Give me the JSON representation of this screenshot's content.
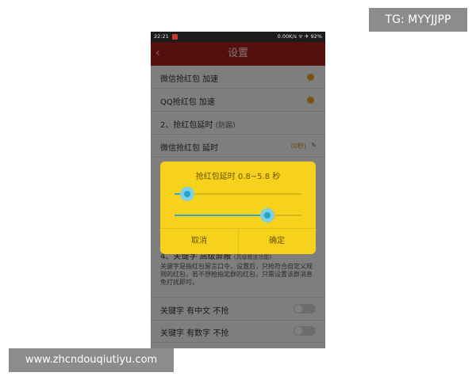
{
  "watermarks": {
    "tg": "TG: MYYJJPP",
    "url": "www.zhcndouqiutiyu.com"
  },
  "statusbar": {
    "time": "22:21",
    "right": "0.00K/s  ᯤ  ✈  92%"
  },
  "header": {
    "back_icon": "‹",
    "title": "设置"
  },
  "settings": {
    "wechat_speed": "微信抢红包 加速",
    "qq_speed": "QQ抢红包 加速",
    "delay_section": "2、抢红包延时",
    "delay_hint": "(防踢)",
    "wechat_delay": "微信抢红包 延时",
    "wechat_delay_value": "(0秒)",
    "keyword_section": "4、关键字 高级屏蔽",
    "keyword_hint": "(高级螺迷功能)",
    "keyword_desc": "关键字是指红包留言口令，设置后，只抢符合自定义规则的红包，若不想抢指定群的红包，只需设置该群消息免打扰即可。",
    "kw_chinese": "关键字 有中文 不抢",
    "kw_number": "关键字 有数字 不抢"
  },
  "dialog": {
    "title": "抢红包延时 0.8~5.8 秒",
    "slider_min_fraction": 0.1,
    "slider_max_fraction": 0.73,
    "cancel": "取消",
    "confirm": "确定"
  },
  "colors": {
    "titlebar": "#a31c1c",
    "dialog": "#f6d21c",
    "accent": "#23a3c8",
    "toggle_on": "#e0a41f"
  }
}
